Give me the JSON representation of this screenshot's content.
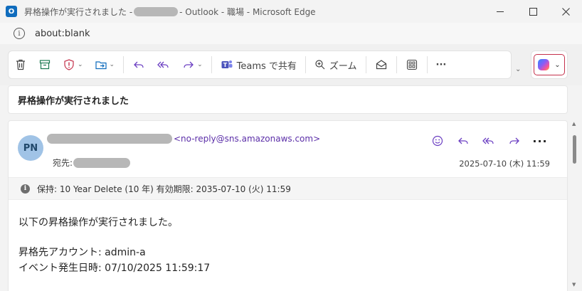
{
  "window": {
    "title_prefix": "昇格操作が実行されました -",
    "title_suffix": "- Outlook - 職場 - Microsoft Edge",
    "app_icon_letter": "O"
  },
  "address": {
    "url": "about:blank"
  },
  "ribbon": {
    "teams_label": "Teams で共有",
    "zoom_label": "ズーム",
    "more_label": "···"
  },
  "subject": "昇格操作が実行されました",
  "message": {
    "avatar_initials": "PN",
    "from_email": "<no-reply@sns.amazonaws.com>",
    "to_label": "宛先:",
    "datetime": "2025-07-10 (木) 11:59",
    "retention": "保持: 10 Year Delete (10 年) 有効期限: 2035-07-10 (火) 11:59",
    "body_lines": [
      "以下の昇格操作が実行されました。",
      "昇格先アカウント: admin-a",
      "イベント発生日時: 07/10/2025 11:59:17"
    ],
    "more_actions": "···"
  },
  "colors": {
    "accent_purple": "#6b3fc2",
    "email_link": "#5b2ea8",
    "avatar_bg": "#a0c3e6",
    "outlook_blue": "#0f6cbd",
    "copilot_border": "#c4314b"
  }
}
